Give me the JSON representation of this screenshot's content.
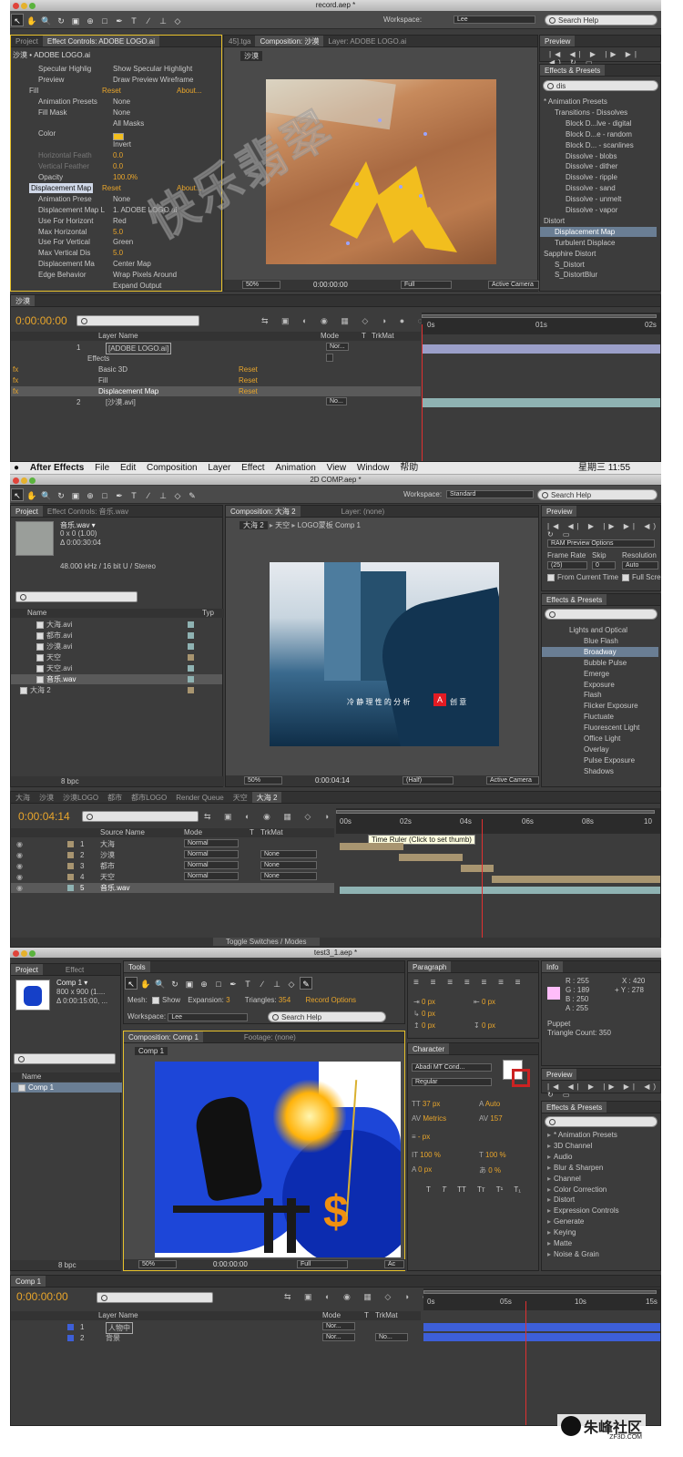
{
  "shot1": {
    "title": "record.aep *",
    "workspace_label": "Workspace:",
    "workspace_value": "Lee",
    "search_help": "Search Help",
    "tabs": [
      "Project",
      "Effect Controls: ADOBE LOGO.ai",
      "45].tga",
      "Composition: 沙漠",
      "Layer: ADOBE LOGO.ai"
    ],
    "comp_breadcrumb": "沙漠",
    "effect_header": "沙漠 • ADOBE LOGO.ai",
    "effect_rows": [
      {
        "label": "Specular Highlig",
        "value": "Show Specular Highlight"
      },
      {
        "label": "Preview",
        "value": "Draw Preview Wireframe"
      },
      {
        "label": "Fill",
        "value": "Reset",
        "extra": "About..."
      },
      {
        "label": "Animation Presets",
        "value": "None"
      },
      {
        "label": "Fill Mask",
        "value": "None"
      },
      {
        "label": "",
        "value": "All Masks"
      },
      {
        "label": "Color",
        "value": ""
      },
      {
        "label": "",
        "value": "Invert"
      },
      {
        "label": "Horizontal Feath",
        "value": "0.0"
      },
      {
        "label": "Vertical Feather",
        "value": "0.0"
      },
      {
        "label": "Opacity",
        "value": "100.0%"
      },
      {
        "label": "Displacement Map",
        "value": "Reset",
        "extra": "About..."
      },
      {
        "label": "Animation Prese",
        "value": "None"
      },
      {
        "label": "Displacement Map L",
        "value": "1. ADOBE LOGO.ai"
      },
      {
        "label": "Use For Horizont",
        "value": "Red"
      },
      {
        "label": "Max Horizontal",
        "value": "5.0"
      },
      {
        "label": "Use For Vertical",
        "value": "Green"
      },
      {
        "label": "Max Vertical Dis",
        "value": "5.0"
      },
      {
        "label": "Displacement Ma",
        "value": "Center Map"
      },
      {
        "label": "Edge Behavior",
        "value": "Wrap Pixels Around"
      },
      {
        "label": "",
        "value": "Expand Output"
      }
    ],
    "viewer_bar": {
      "zoom": "50%",
      "time": "0:00:00:00",
      "res": "Full",
      "camera": "Active Camera"
    },
    "preview_tab": "Preview",
    "effects_tab": "Effects & Presets",
    "effects_search": "dis",
    "effects_list": [
      {
        "label": "* Animation Presets",
        "indent": 0
      },
      {
        "label": "Transitions - Dissolves",
        "indent": 1
      },
      {
        "label": "Block D...lve - digital",
        "indent": 2
      },
      {
        "label": "Block D...e - random",
        "indent": 2
      },
      {
        "label": "Block D... - scanlines",
        "indent": 2
      },
      {
        "label": "Dissolve - blobs",
        "indent": 2
      },
      {
        "label": "Dissolve - dither",
        "indent": 2
      },
      {
        "label": "Dissolve - ripple",
        "indent": 2
      },
      {
        "label": "Dissolve - sand",
        "indent": 2
      },
      {
        "label": "Dissolve - unmelt",
        "indent": 2
      },
      {
        "label": "Dissolve - vapor",
        "indent": 2
      },
      {
        "label": "Distort",
        "indent": 0
      },
      {
        "label": "Displacement Map",
        "indent": 1
      },
      {
        "label": "Turbulent Displace",
        "indent": 1
      },
      {
        "label": "Sapphire Distort",
        "indent": 0
      },
      {
        "label": "S_Distort",
        "indent": 1
      },
      {
        "label": "S_DistortBlur",
        "indent": 1
      }
    ],
    "timeline_tab": "沙漠",
    "timecode": "0:00:00:00",
    "col_layer": "Layer Name",
    "col_mode": "Mode",
    "col_t": "T",
    "col_trkmat": "TrkMat",
    "ruler": [
      "0s",
      "01s",
      "02s"
    ],
    "layers": [
      {
        "num": "1",
        "name": "[ADOBE LOGO.ai]",
        "mode": "Nor..."
      },
      {
        "num": "",
        "name": "Effects",
        "mode": ""
      },
      {
        "num": "",
        "name": "Basic 3D",
        "mode": "Reset"
      },
      {
        "num": "",
        "name": "Fill",
        "mode": "Reset"
      },
      {
        "num": "",
        "name": "Displacement Map",
        "mode": "Reset"
      },
      {
        "num": "2",
        "name": "[沙漠.avi]",
        "mode": "No..."
      }
    ],
    "fx_label": "fx"
  },
  "shot2": {
    "title": "2D COMP.aep *",
    "menu": [
      "After Effects",
      "File",
      "Edit",
      "Composition",
      "Layer",
      "Effect",
      "Animation",
      "View",
      "Window",
      "帮助"
    ],
    "clock": "星期三 11:55",
    "workspace_label": "Workspace:",
    "workspace_value": "Standard",
    "search_help": "Search Help",
    "tabs": [
      "Project",
      "Effect Controls: 音乐.wav",
      "Composition: 大海 2",
      "Layer: (none)"
    ],
    "breadcrumbs": [
      "大海 2",
      "天空",
      "LOGO蒙板 Comp 1"
    ],
    "project_item": "音乐.wav ▾",
    "project_info": [
      "0 x 0 (1.00)",
      "Δ 0:00:30:04",
      "",
      "48.000 kHz / 16 bit U / Stereo"
    ],
    "project_cols": [
      "Name",
      "Typ"
    ],
    "project_files": [
      "大海.avi",
      "都市.avi",
      "沙漠.avi",
      "天空",
      "天空.avi",
      "音乐.wav",
      "大海 2"
    ],
    "bpc": "8 bpc",
    "car_caption": "冷 静 理 性 的 分 析",
    "car_caption2": "创 意",
    "viewer_bar": {
      "zoom": "50%",
      "time": "0:00:04:14",
      "res": "(Half)",
      "camera": "Active Camera"
    },
    "preview_tab": "Preview",
    "ram_preview": "RAM Preview Options",
    "frame_rate_label": "Frame Rate",
    "skip_label": "Skip",
    "resolution_label": "Resolution",
    "frame_rate": "(25)",
    "skip": "0",
    "resolution": "Auto",
    "from_current": "From Current Time",
    "full_screen": "Full Screen",
    "effects_tab": "Effects & Presets",
    "effects_list": [
      "Lights and Optical",
      "Blue Flash",
      "Broadway",
      "Bubble Pulse",
      "Emerge",
      "Exposure",
      "Flash",
      "Flicker Exposure",
      "Fluctuate",
      "Fluorescent Light",
      "Office Light",
      "Overlay",
      "Pulse Exposure",
      "Shadows"
    ],
    "timeline_tabs": [
      "大海",
      "沙漠",
      "沙漠LOGO",
      "都市",
      "都市LOGO",
      "Render Queue",
      "天空",
      "大海 2"
    ],
    "timecode": "0:00:04:14",
    "ruler": [
      "00s",
      "02s",
      "04s",
      "06s",
      "08s",
      "10"
    ],
    "tooltip": "Time Ruler (Click to set thumb)",
    "col_source": "Source Name",
    "col_mode": "Mode",
    "col_t": "T",
    "col_trkmat": "TrkMat",
    "layers": [
      {
        "num": "1",
        "name": "大海",
        "mode": "Normal",
        "trk": ""
      },
      {
        "num": "2",
        "name": "沙漠",
        "mode": "Normal",
        "trk": "None"
      },
      {
        "num": "3",
        "name": "都市",
        "mode": "Normal",
        "trk": "None"
      },
      {
        "num": "4",
        "name": "天空",
        "mode": "Normal",
        "trk": "None"
      },
      {
        "num": "5",
        "name": "音乐.wav",
        "mode": "",
        "trk": ""
      }
    ],
    "toggle": "Toggle Switches / Modes"
  },
  "shot3": {
    "title": "test3_1.aep *",
    "tabs": [
      "Project",
      "Effect",
      "Tools",
      "Paragraph",
      "Info"
    ],
    "project_item": "Comp 1 ▾",
    "project_info": [
      "800 x 900 (1....",
      "Δ 0:00:15:00, ..."
    ],
    "project_col": "Name",
    "project_file": "Comp 1",
    "bpc": "8 bpc",
    "mesh_label": "Mesh:",
    "mesh_show": "Show",
    "expansion_label": "Expansion:",
    "expansion_value": "3",
    "triangles_label": "Triangles:",
    "triangles_value": "354",
    "record_options": "Record Options",
    "workspace_label": "Workspace:",
    "workspace_value": "Lee",
    "search_help": "Search Help",
    "comp_tab": "Composition: Comp 1",
    "footage_tab": "Footage: (none)",
    "comp_breadcrumb": "Comp 1",
    "viewer_bar": {
      "zoom": "50%",
      "time": "0:00:00:00",
      "res": "Full",
      "camera": "Ac"
    },
    "info": {
      "r": "R : 255",
      "g": "G : 189",
      "b": "B : 250",
      "a": "A : 255",
      "x": "X : 420",
      "y": "+ Y : 278"
    },
    "puppet": "Puppet",
    "triangle_count": "Triangle Count: 350",
    "para_values": [
      "0 px",
      "0 px",
      "0 px",
      "0 px",
      "0 px"
    ],
    "character_tab": "Character",
    "font_name": "Abadi MT Cond...",
    "font_style": "Regular",
    "font_size": "37 px",
    "leading": "Auto",
    "kerning": "Metrics",
    "tracking": "157",
    "baseline": "- px",
    "vscale": "100 %",
    "hscale": "100 %",
    "shift": "0 px",
    "tsume": "0 %",
    "text_styles": [
      "T",
      "T",
      "TT",
      "Tт",
      "T¹",
      "T₁"
    ],
    "preview_tab": "Preview",
    "effects_tab": "Effects & Presets",
    "effects_list": [
      "* Animation Presets",
      "3D Channel",
      "Audio",
      "Blur & Sharpen",
      "Channel",
      "Color Correction",
      "Distort",
      "Expression Controls",
      "Generate",
      "Keying",
      "Matte",
      "Noise & Grain"
    ],
    "timeline_tab": "Comp 1",
    "timecode": "0:00:00:00",
    "col_layer": "Layer Name",
    "col_mode": "Mode",
    "col_t": "T",
    "col_trkmat": "TrkMat",
    "ruler": [
      "0s",
      "05s",
      "10s",
      "15s"
    ],
    "layers": [
      {
        "num": "1",
        "name": "人物中",
        "mode": "Nor...",
        "trk": ""
      },
      {
        "num": "2",
        "name": "背景",
        "mode": "Nor...",
        "trk": "No..."
      }
    ]
  },
  "watermark": "朱峰社区",
  "watermark_sub": "ZF3D.COM",
  "colors": {
    "accent": "#e8a52b",
    "panel": "#3c3c3c",
    "timeline_bar": "#8fb3b3",
    "playhead": "#e03030"
  }
}
